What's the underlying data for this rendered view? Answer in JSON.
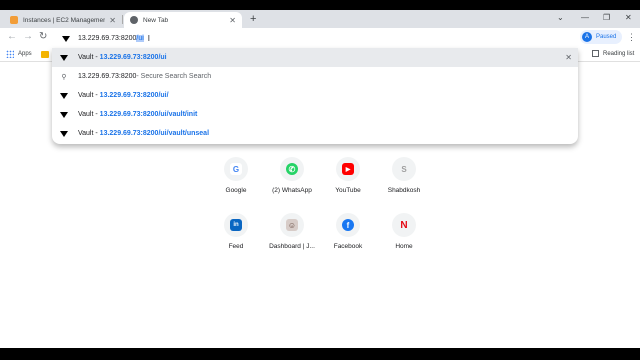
{
  "tabs": [
    {
      "title": "Instances | EC2 Management Co...",
      "favicon_color": "#f29d38"
    },
    {
      "title": "New Tab",
      "favicon_color": "#5f6368"
    }
  ],
  "toolbar": {
    "omnibox_text": "13.229.69.73:8200",
    "omnibox_selected": "/ui",
    "profile_initial": "A",
    "profile_status": "Paused"
  },
  "bookmarks": {
    "apps_label": "Apps",
    "reading_list_label": "Reading list"
  },
  "suggestions": [
    {
      "icon": "vault-icon",
      "prefix": "Vault - ",
      "url": "13.229.69.73:8200",
      "tail": "/ui",
      "highlighted": true
    },
    {
      "icon": "search-icon",
      "prefix": "",
      "url": "13.229.69.73:8200",
      "tail": " - Secure Search Search",
      "highlighted": false
    },
    {
      "icon": "vault-icon",
      "prefix": "Vault - ",
      "url": "13.229.69.73:8200",
      "tail": "/ui/",
      "highlighted": false
    },
    {
      "icon": "vault-icon",
      "prefix": "Vault - ",
      "url": "13.229.69.73:8200",
      "tail": "/ui/vault/init",
      "highlighted": false
    },
    {
      "icon": "vault-icon",
      "prefix": "Vault - ",
      "url": "13.229.69.73:8200",
      "tail": "/ui/vault/unseal",
      "highlighted": false
    }
  ],
  "shortcuts": [
    {
      "label": "Google",
      "letter": "G",
      "color": "#4285f4"
    },
    {
      "label": "(2) WhatsApp",
      "letter": "✆",
      "color": "#25d366"
    },
    {
      "label": "YouTube",
      "letter": "▶",
      "color": "#ff0000"
    },
    {
      "label": "Shabdkosh",
      "letter": "S",
      "color": "#9e9e9e"
    },
    {
      "label": "Feed",
      "letter": "in",
      "color": "#0a66c2"
    },
    {
      "label": "Dashboard | J...",
      "letter": "☺",
      "color": "#8d6e63"
    },
    {
      "label": "Facebook",
      "letter": "f",
      "color": "#1877f2"
    },
    {
      "label": "Home",
      "letter": "N",
      "color": "#e50914"
    }
  ]
}
